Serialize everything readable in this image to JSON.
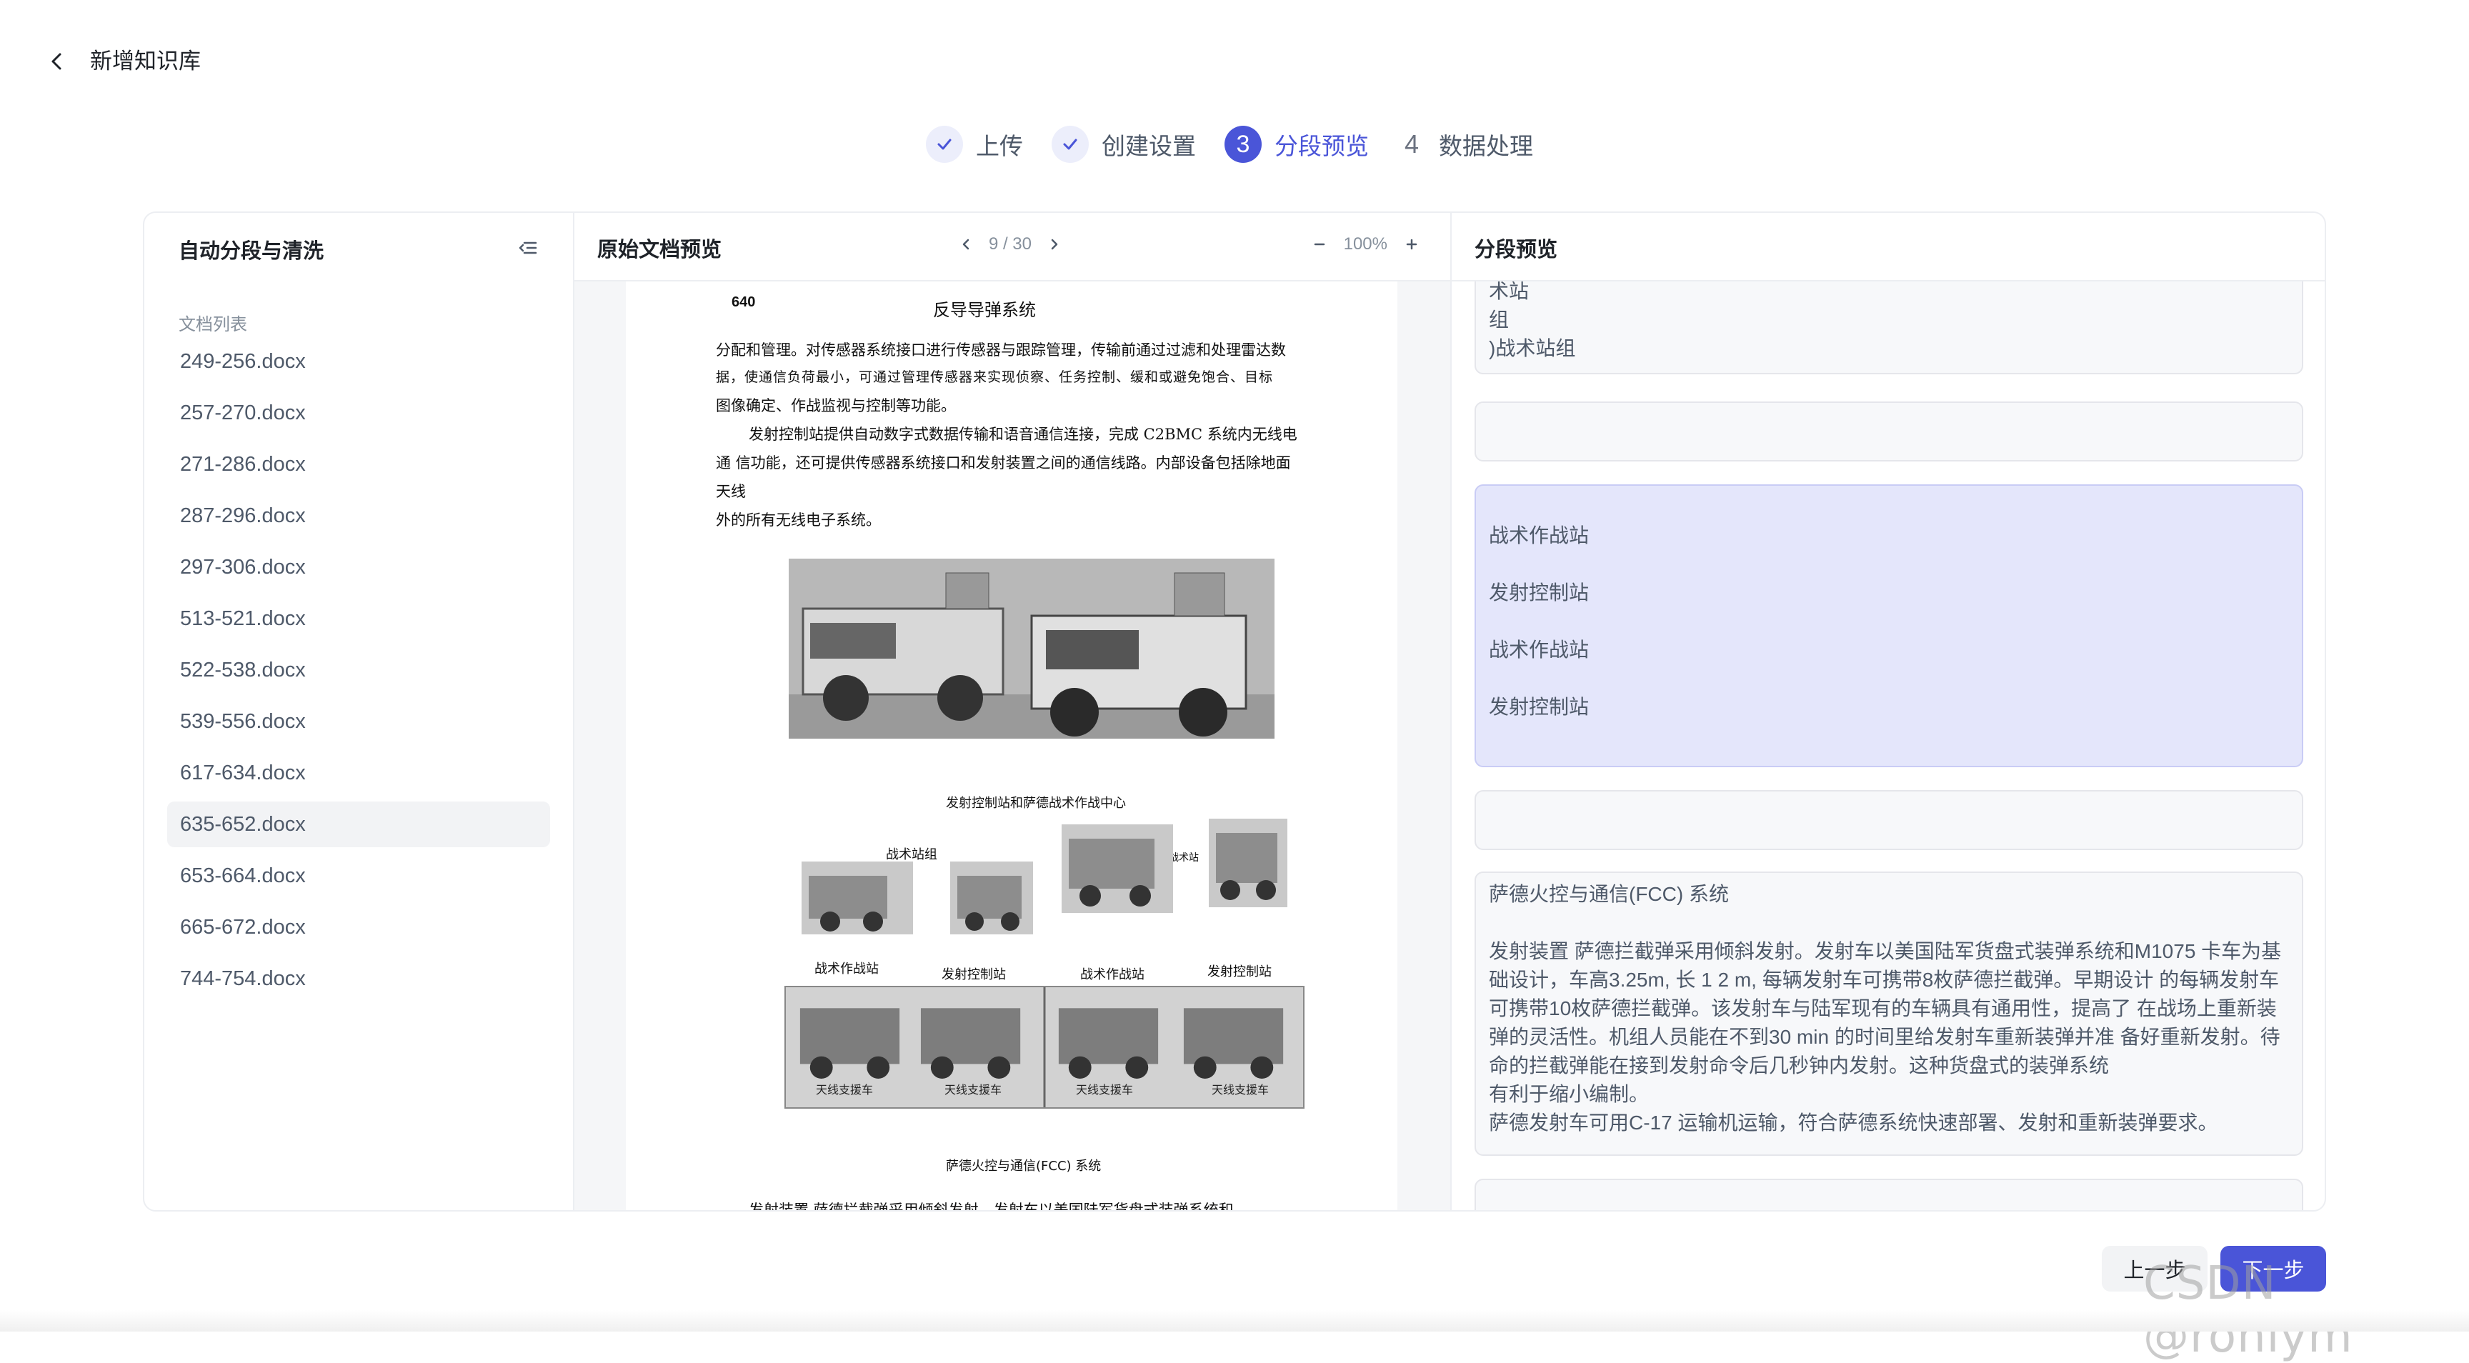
{
  "header": {
    "title": "新增知识库"
  },
  "steps": [
    {
      "number": "",
      "label": "上传",
      "state": "done"
    },
    {
      "number": "",
      "label": "创建设置",
      "state": "done"
    },
    {
      "number": "3",
      "label": "分段预览",
      "state": "active"
    },
    {
      "number": "4",
      "label": "数据处理",
      "state": "todo"
    }
  ],
  "left_panel": {
    "title": "自动分段与清洗",
    "list_label": "文档列表",
    "documents": [
      "249-256.docx",
      "257-270.docx",
      "271-286.docx",
      "287-296.docx",
      "297-306.docx",
      "513-521.docx",
      "522-538.docx",
      "539-556.docx",
      "617-634.docx",
      "635-652.docx",
      "653-664.docx",
      "665-672.docx",
      "744-754.docx"
    ],
    "selected_document": "635-652.docx"
  },
  "mid_panel": {
    "title": "原始文档预览",
    "page_indicator": "9 / 30",
    "zoom": "100%",
    "doc": {
      "page_number": "640",
      "heading": "反导导弹系统",
      "para1": "分配和管理。对传感器系统接口进行传感器与跟踪管理，传输前通过过滤和处理雷达数",
      "para2": "据，使通信负荷最小，可通过管理传感器来实现侦察、任务控制、缓和或避免饱合、目标",
      "para3": "图像确定、作战监视与控制等功能。",
      "para4": "发射控制站提供自动数字式数据传输和语音通信连接，完成 C2BMC 系统内无线电",
      "para5": "通 信功能，还可提供传感器系统接口和发射装置之间的通信线路。内部设备包括除地面",
      "para6": "天线",
      "para7": "外的所有无线电子系统。",
      "fig1_caption": "发射控制站和萨德战术作战中心",
      "label_tactical_group": "战术站组",
      "label_tactical_group_2": "战术站",
      "label_tac_op_1": "战术作战站",
      "label_launch_ctrl_1": "发射控制站",
      "label_tac_op_2": "战术作战站",
      "label_launch_ctrl_2": "发射控制站",
      "veh_1": "天线支援车",
      "veh_2": "天线支援车",
      "veh_3": "天线支援车",
      "veh_4": "天线支援车",
      "fig2_caption": "萨德火控与通信(FCC)  系统",
      "para_cut": "发射装置  萨德拦截弹采用倾斜发射，发射车以美国陆军货盘式装弹系统和"
    }
  },
  "right_panel": {
    "title": "分段预览",
    "segments": [
      {
        "lines": [
          "术站",
          "组",
          ")战术站组"
        ],
        "highlight": false
      },
      {
        "lines": [],
        "highlight": false
      },
      {
        "lines": [
          "",
          "战术作战站",
          "",
          "发射控制站",
          "",
          "战术作战站",
          "",
          "发射控制站"
        ],
        "highlight": true
      },
      {
        "lines": [],
        "highlight": false
      },
      {
        "lines": [
          "萨德火控与通信(FCC) 系统",
          "",
          "发射装置 萨德拦截弹采用倾斜发射。发射车以美国陆军货盘式装弹系统和M1075 卡车为基",
          "础设计，车高3.25m, 长 1 2 m, 每辆发射车可携带8枚萨德拦截弹。早期设计 的每辆发射车",
          "可携带10枚萨德拦截弹。该发射车与陆军现有的车辆具有通用性，提高了 在战场上重新装",
          "弹的灵活性。机组人员能在不到30 min 的时间里给发射车重新装弹并准 备好重新发射。待",
          "命的拦截弹能在接到发射命令后几秒钟内发射。这种货盘式的装弹系统",
          "有利于缩小编制。",
          "萨德发射车可用C-17 运输机运输，符合萨德系统快速部署、发射和重新装弹要求。"
        ],
        "highlight": false
      },
      {
        "lines": [],
        "highlight": false
      }
    ]
  },
  "footer": {
    "prev_label": "上一步",
    "next_label": "下一步"
  },
  "watermark": "CSDN @ronlym",
  "colors": {
    "accent": "#4a55d8",
    "highlight": "#e4e6fb",
    "done_bg": "#eceefb"
  }
}
